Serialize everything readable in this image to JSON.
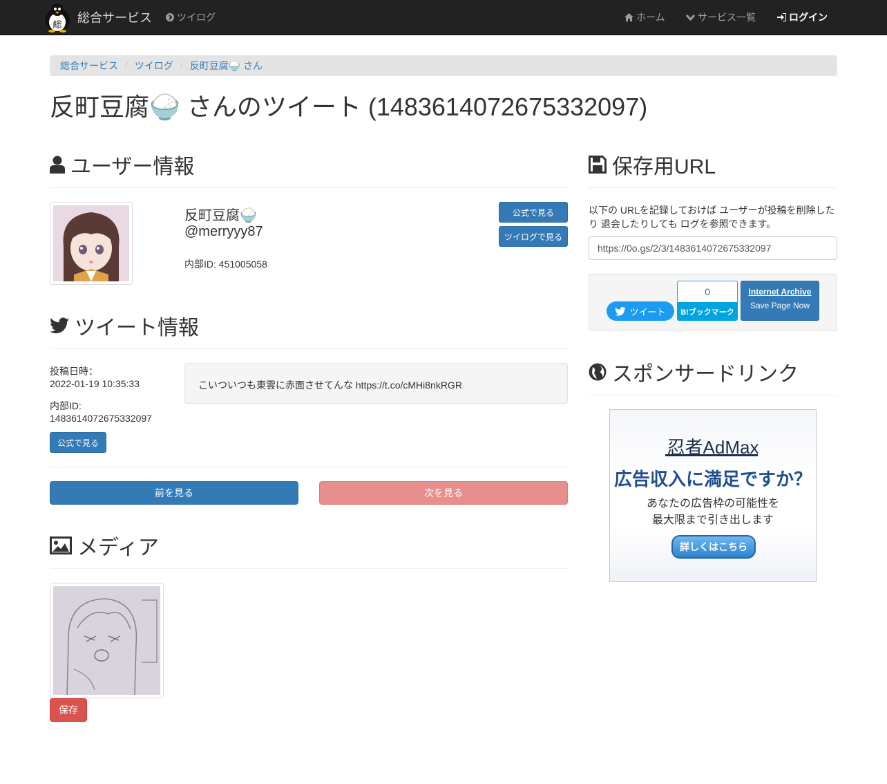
{
  "navbar": {
    "brand": "総合サービス",
    "logo_char": "総",
    "tweetlog_link": "ツイログ",
    "home": "ホーム",
    "services": "サービス一覧",
    "login": "ログイン"
  },
  "breadcrumb": [
    "総合サービス",
    "ツイログ",
    "反町豆腐🍚 さん"
  ],
  "page_title": "反町豆腐🍚 さんのツイート (1483614072675332097)",
  "user_section": {
    "heading": "ユーザー情報",
    "display_name": "反町豆腐🍚",
    "handle": "@merryyy87",
    "internal_id": "内部ID: 451005058",
    "btn_official": "公式で見る",
    "btn_tweetlog": "ツイログで見る"
  },
  "tweet_section": {
    "heading": "ツイート情報",
    "posted_label": "投稿日時：",
    "posted_value": "2022-01-19 10:35:33",
    "id_label": "内部ID:",
    "id_value": "1483614072675332097",
    "btn_official": "公式で見る",
    "text": "こいついつも東雲に赤面させてんな https://t.co/cMHi8nkRGR",
    "prev": "前を見る",
    "next": "次を見る"
  },
  "media_section": {
    "heading": "メディア",
    "save": "保存"
  },
  "save_url": {
    "heading": "保存用URL",
    "description_1": "以下の URLを記録しておけば ユーザーが投稿を削除した",
    "description_2": "り 退会したりしても ログを参照できます。",
    "url": "https://0o.gs/2/3/1483614072675332097"
  },
  "share": {
    "tweet": "ツイート",
    "hatena_count": "0",
    "hatena_label": "B!ブックマーク",
    "ia_title": "Internet Archive",
    "ia_sub": "Save Page Now"
  },
  "sponsor": {
    "heading": "スポンサードリンク",
    "ad_brand": "忍者AdMax",
    "ad_headline": "広告収入に満足ですか？",
    "ad_body_1": "あなたの広告枠の可能性を",
    "ad_body_2": "最大限まで引き出します",
    "ad_cta": "詳しくはこちら"
  },
  "colors": {
    "navbar": "#222222",
    "primary": "#337ab7",
    "danger": "#d9534f",
    "twitter": "#1d9bf0",
    "hatena": "#00a4de"
  }
}
